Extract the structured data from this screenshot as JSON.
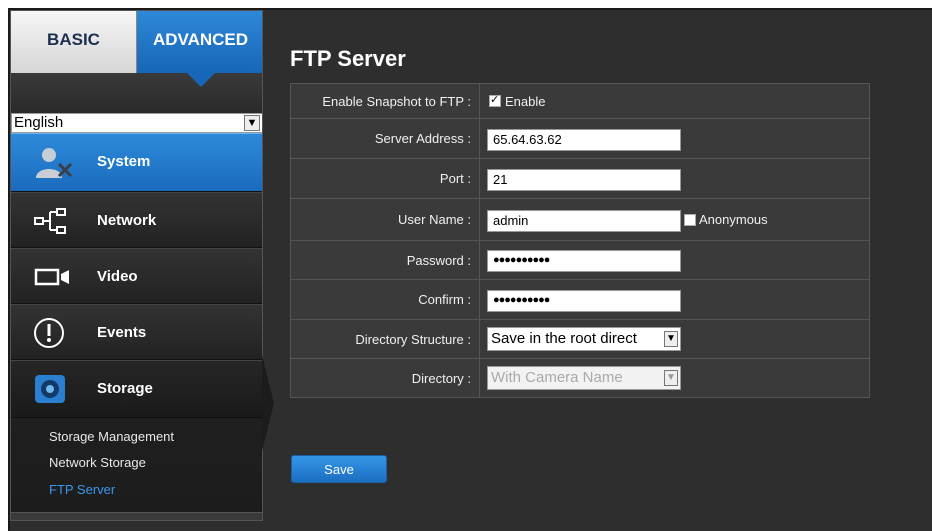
{
  "tabs": {
    "basic": "BASIC",
    "advanced": "ADVANCED"
  },
  "language": {
    "selected": "English"
  },
  "menu": {
    "system": "System",
    "network": "Network",
    "video": "Video",
    "events": "Events",
    "storage": "Storage"
  },
  "submenu": [
    {
      "label": "Storage Management"
    },
    {
      "label": "Network Storage"
    },
    {
      "label": "FTP Server",
      "active": true
    }
  ],
  "page": {
    "title": "FTP Server",
    "fields": {
      "enable_snapshot": {
        "label": "Enable Snapshot to FTP :",
        "option": "Enable",
        "checked": true
      },
      "server_address": {
        "label": "Server Address :",
        "value": "65.64.63.62"
      },
      "port": {
        "label": "Port :",
        "value": "21"
      },
      "user_name": {
        "label": "User Name :",
        "value": "admin",
        "anonymous_label": "Anonymous",
        "anonymous_checked": false
      },
      "password": {
        "label": "Password :",
        "value": "●●●●●●●●●●"
      },
      "confirm": {
        "label": "Confirm :",
        "value": "●●●●●●●●●●"
      },
      "directory_structure": {
        "label": "Directory Structure :",
        "value": "Save in the root direct"
      },
      "directory": {
        "label": "Directory :",
        "value": "With Camera Name"
      }
    },
    "save_label": "Save"
  },
  "colors": {
    "accent": "#1a6bbd",
    "active_link": "#3b97ee",
    "panel": "#3a3a3a"
  }
}
